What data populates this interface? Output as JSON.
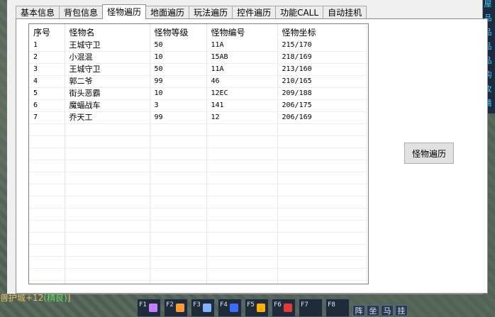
{
  "tabs": [
    {
      "label": "基本信息",
      "active": false
    },
    {
      "label": "背包信息",
      "active": false
    },
    {
      "label": "怪物遍历",
      "active": true
    },
    {
      "label": "地面遍历",
      "active": false
    },
    {
      "label": "玩法遍历",
      "active": false
    },
    {
      "label": "控件遍历",
      "active": false
    },
    {
      "label": "功能CALL",
      "active": false
    },
    {
      "label": "自动挂机",
      "active": false
    }
  ],
  "monster_list": {
    "columns": [
      "序号",
      "怪物名",
      "怪物等级",
      "怪物编号",
      "怪物坐标"
    ],
    "rows": [
      [
        "1",
        "王城守卫",
        "50",
        "11A",
        "215/170"
      ],
      [
        "2",
        "小混混",
        "10",
        "15AB",
        "218/169"
      ],
      [
        "3",
        "王城守卫",
        "50",
        "11A",
        "213/160"
      ],
      [
        "4",
        "郭二爷",
        "99",
        "46",
        "210/165"
      ],
      [
        "5",
        "街头恶霸",
        "10",
        "12EC",
        "209/188"
      ],
      [
        "6",
        "魔蝠战车",
        "3",
        "141",
        "206/175"
      ],
      [
        "7",
        "乔天工",
        "99",
        "12",
        "206/169"
      ]
    ]
  },
  "traverse_button_label": "怪物遍历",
  "game_hud": {
    "side_strip": [
      "屋",
      "品",
      "品",
      "品",
      "品",
      "购",
      "攻",
      "精"
    ],
    "bottom_text_prefix": "兽护城+12",
    "bottom_text_tag": "(精良)",
    "bottom_text_suffix": "]",
    "hotkeys": [
      "F1",
      "F2",
      "F3",
      "F4",
      "F5",
      "F6",
      "F7",
      "F8"
    ],
    "actions": [
      "阵",
      "坐",
      "马",
      "挂"
    ]
  },
  "colors": {
    "window_bg": "#f0f0f0",
    "panel_bg": "#ffffff",
    "button_bg": "#e1e1e1",
    "hud_text": "#e8c060",
    "hud_green": "#5ee05e"
  }
}
